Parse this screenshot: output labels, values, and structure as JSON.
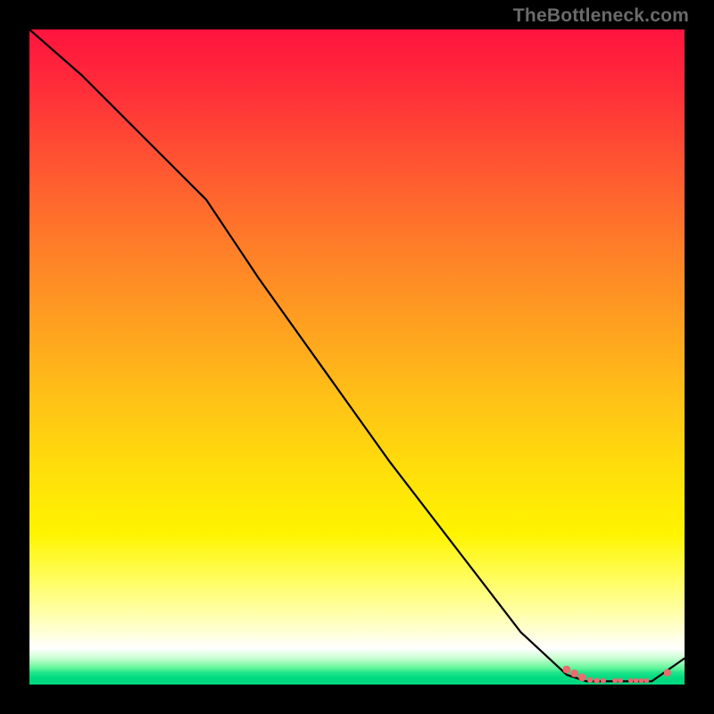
{
  "watermark": {
    "text": "TheBottleneck.com"
  },
  "chart_data": {
    "type": "line",
    "title": "",
    "xlabel": "",
    "ylabel": "",
    "xlim": [
      0,
      100
    ],
    "ylim": [
      0,
      100
    ],
    "series": [
      {
        "name": "curve",
        "color": "#000000",
        "x": [
          0,
          8,
          16,
          23,
          27,
          35,
          45,
          55,
          65,
          75,
          82,
          85,
          87,
          90,
          93,
          95,
          100
        ],
        "y": [
          100,
          93,
          85,
          78,
          74,
          62,
          48,
          34,
          21,
          8,
          1.5,
          0.5,
          0.5,
          0.5,
          0.5,
          0.5,
          4
        ]
      }
    ],
    "markers": [
      {
        "name": "marker-a",
        "x": 82.0,
        "y": 2.3,
        "r": 4.4,
        "color": "#ed6a6f"
      },
      {
        "name": "marker-b",
        "x": 83.2,
        "y": 1.7,
        "r": 4.4,
        "color": "#ed6a6f"
      },
      {
        "name": "marker-c",
        "x": 84.4,
        "y": 1.1,
        "r": 4.4,
        "color": "#ed6a6f"
      },
      {
        "name": "marker-d",
        "x": 85.6,
        "y": 0.7,
        "r": 3.2,
        "color": "#ed6a6f"
      },
      {
        "name": "marker-e",
        "x": 86.6,
        "y": 0.6,
        "r": 3.2,
        "color": "#ed6a6f"
      },
      {
        "name": "marker-f",
        "x": 87.6,
        "y": 0.6,
        "r": 3.0,
        "color": "#ed6a6f"
      },
      {
        "name": "marker-g",
        "x": 89.4,
        "y": 0.6,
        "r": 2.9,
        "color": "#ed6a6f"
      },
      {
        "name": "marker-h",
        "x": 90.2,
        "y": 0.6,
        "r": 2.9,
        "color": "#ed6a6f"
      },
      {
        "name": "marker-i",
        "x": 91.8,
        "y": 0.6,
        "r": 2.8,
        "color": "#ed6a6f"
      },
      {
        "name": "marker-j",
        "x": 92.6,
        "y": 0.6,
        "r": 2.8,
        "color": "#ed6a6f"
      },
      {
        "name": "marker-k",
        "x": 93.4,
        "y": 0.6,
        "r": 2.8,
        "color": "#ed6a6f"
      },
      {
        "name": "marker-l",
        "x": 94.2,
        "y": 0.6,
        "r": 2.9,
        "color": "#ed6a6f"
      },
      {
        "name": "marker-m",
        "x": 97.4,
        "y": 1.8,
        "r": 4.2,
        "color": "#ed6a6f"
      }
    ]
  }
}
